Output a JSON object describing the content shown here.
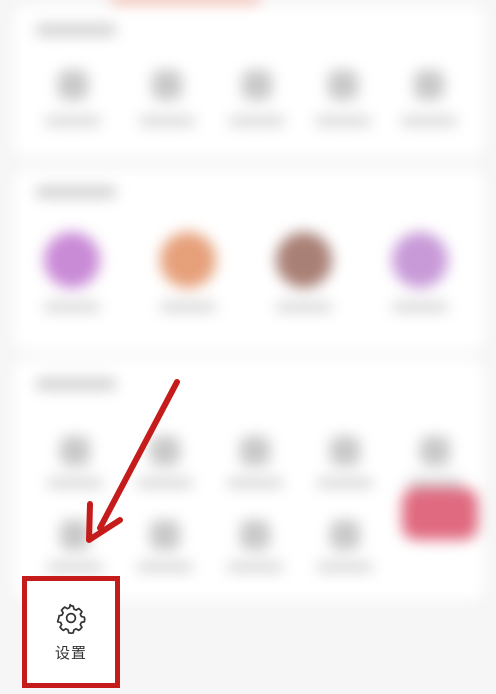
{
  "settings": {
    "label": "设置",
    "icon": "gear-icon"
  },
  "annotation": {
    "highlight_color": "#c51b1b",
    "arrow_color": "#c51b1b"
  },
  "colors": {
    "accent": "#f2b9ad",
    "badge_pink": "#e06a80"
  }
}
